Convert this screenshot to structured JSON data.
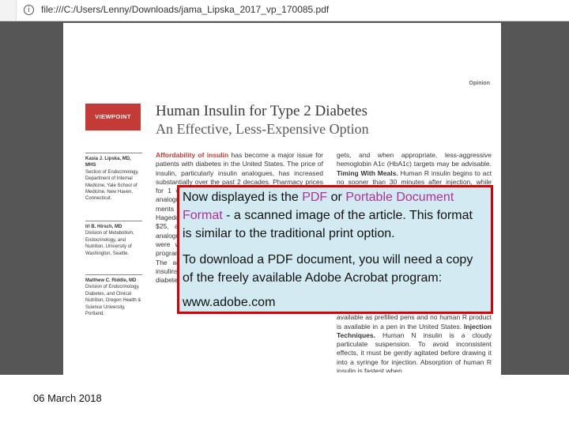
{
  "browser": {
    "url": "file:///C:/Users/Lenny/Downloads/jama_Lipska_2017_vp_170085.pdf",
    "info_icon": "info-icon"
  },
  "article": {
    "section": "Opinion",
    "label": "VIEWPOINT",
    "title": "Human Insulin for Type 2 Diabetes",
    "subtitle": "An Effective, Less-Expensive Option",
    "authors": [
      {
        "name": "Kasia J. Lipska, MD, MHS",
        "affiliation": "Section of Endocrinology, Department of Internal Medicine, Yale School of Medicine, New Haven, Connecticut."
      },
      {
        "name": "Irl B. Hirsch, MD",
        "affiliation": "Division of Metabolism, Endocrinology, and Nutrition, University of Washington, Seattle."
      },
      {
        "name": "Matthew C. Riddle, MD",
        "affiliation": "Division of Endocrinology, Diabetes, and Clinical Nutrition, Oregon Health & Science University, Portland."
      }
    ],
    "col1_lead": "Affordability of insulin",
    "col1_text": " has become a major issue for patients with diabetes in the United States. The price of insulin, particularly insulin analogues, has increased substantially over the past 2 decades. Pharmacy prices for 1 vial of insulin analogues or a pack of insulin analogue injectors ... some drug lists ... to patients ... ments ... many of ... Sy ... treatment ... scribe ... Hagedorn ... 70/30 ... can be obtained for as little as $25, approximately one-tenth of the list price of analogues. Although strategies for using human insulins were well understood 20 years ago, most training programs no longer emphasize the use of these agents. The advantages of insulin analogues over human insulins are less clear for type 2 diabetes than for type 1 diabetes. For patients with",
    "col2_text_top": "gets, and when appropriate, less-aggressive hemoglobin A1c (HbA1c) targets may be advisable.",
    "col2_lead": "Timing With Meals.",
    "col2_text_mid": " Human R insulin begins to act no sooner than 30 minutes after injection, while rapid-",
    "col2_text_bottom": "expensive human insulin products ... are not available as prefilled pens and no human R product is available in a pen in the United States.",
    "col2_lead2": "Injection Techniques.",
    "col2_text_end": " Human N insulin is a cloudy particulate suspension. To avoid inconsistent effects, it must be gently agitated before drawing it into a syringe for injection. Absorption of human R insulin is fastest when"
  },
  "overlay": {
    "l1a": "Now displayed is the ",
    "l1b": "PDF",
    "l1c": " or ",
    "l1d": "Portable Document",
    "l2a": "Format",
    "l2b": " - a scanned image of the article.  This format",
    "l3": "is similar to the traditional print option.",
    "l4": "To download a PDF document, you will need a copy",
    "l5": "of the freely available Adobe Acrobat program:",
    "l6": "www.adobe.com"
  },
  "footer": {
    "date": "06 March 2018"
  },
  "colors": {
    "accent_red": "#c33a36",
    "overlay_bg": "#d2ebf3",
    "overlay_border": "#d40000",
    "highlight": "#b0309c"
  }
}
